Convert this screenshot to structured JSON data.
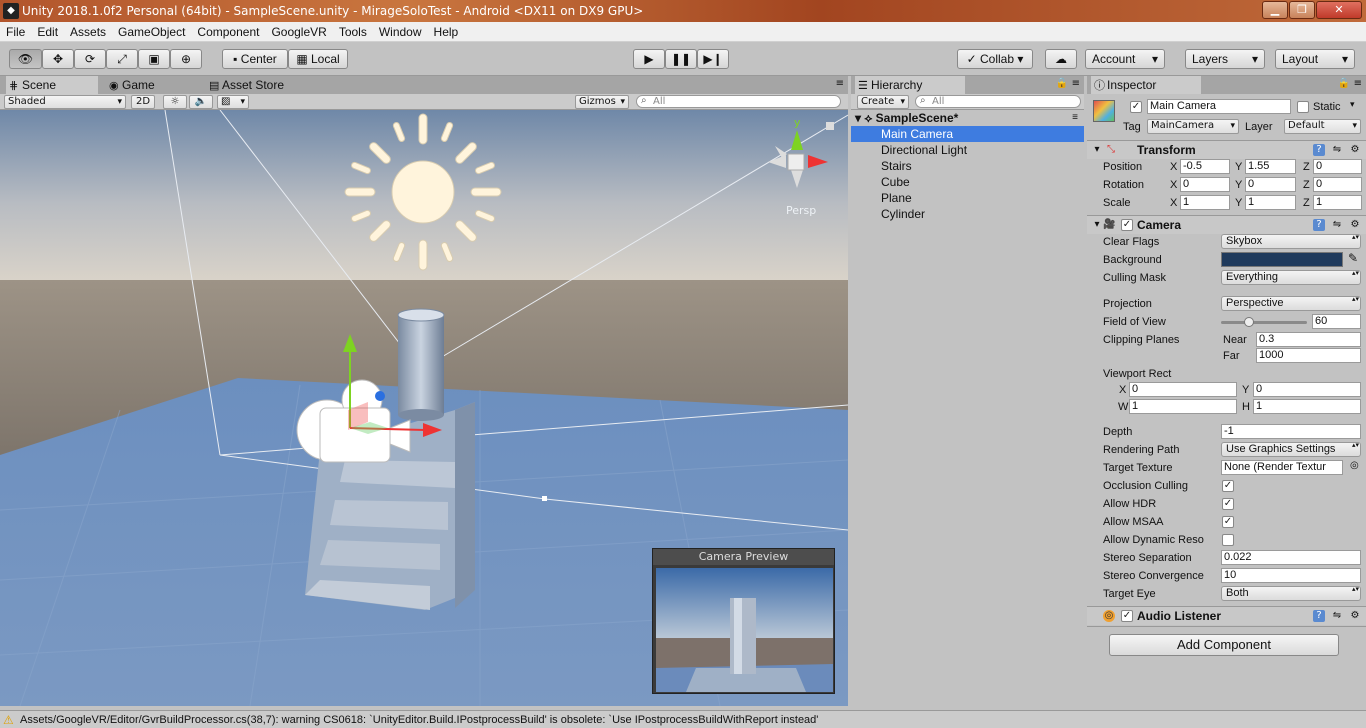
{
  "window": {
    "title": "Unity 2018.1.0f2 Personal (64bit) - SampleScene.unity - MirageSoloTest - Android <DX11 on DX9 GPU>",
    "logo_icon": "unity-logo-icon",
    "buttons": [
      "minimize-icon",
      "maximize-icon",
      "close-icon"
    ]
  },
  "menu": [
    "File",
    "Edit",
    "Assets",
    "GameObject",
    "Component",
    "GoogleVR",
    "Tools",
    "Window",
    "Help"
  ],
  "toolbar": {
    "tools": [
      "hand-tool-icon",
      "move-tool-icon",
      "rotate-tool-icon",
      "scale-tool-icon",
      "rect-tool-icon",
      "transform-tool-icon"
    ],
    "pivot_label": "Center",
    "space_label": "Local",
    "play_icons": [
      "play-icon",
      "pause-icon",
      "step-icon"
    ],
    "collab_label": "Collab",
    "account_label": "Account",
    "layers_label": "Layers",
    "layout_label": "Layout"
  },
  "scene_panel": {
    "tabs": [
      "Scene",
      "Game",
      "Asset Store"
    ],
    "shading_mode": "Shaded",
    "mode_2d": "2D",
    "gizmos_label": "Gizmos",
    "search_placeholder": "All",
    "persp_label": "Persp",
    "gizmo_axis_y": "y",
    "camera_preview_title": "Camera Preview"
  },
  "hierarchy": {
    "tab_label": "Hierarchy",
    "create_label": "Create",
    "search_placeholder": "All",
    "scene_name": "SampleScene*",
    "items": [
      "Main Camera",
      "Directional Light",
      "Stairs",
      "Cube",
      "Plane",
      "Cylinder"
    ],
    "selected": "Main Camera"
  },
  "inspector": {
    "tab_label": "Inspector",
    "object_name": "Main Camera",
    "static_label": "Static",
    "tag_label": "Tag",
    "tag_value": "MainCamera",
    "layer_label": "Layer",
    "layer_value": "Default",
    "transform": {
      "title": "Transform",
      "position_label": "Position",
      "position": {
        "x": "-0.5",
        "y": "1.55",
        "z": "0"
      },
      "rotation_label": "Rotation",
      "rotation": {
        "x": "0",
        "y": "0",
        "z": "0"
      },
      "scale_label": "Scale",
      "scale": {
        "x": "1",
        "y": "1",
        "z": "1"
      }
    },
    "axes": {
      "x": "X",
      "y": "Y",
      "z": "Z",
      "w": "W",
      "h": "H"
    },
    "camera": {
      "title": "Camera",
      "clear_flags_label": "Clear Flags",
      "clear_flags": "Skybox",
      "background_label": "Background",
      "background_color": "#1f3a5c",
      "culling_mask_label": "Culling Mask",
      "culling_mask": "Everything",
      "projection_label": "Projection",
      "projection": "Perspective",
      "fov_label": "Field of View",
      "fov": "60",
      "fov_fraction": 0.33,
      "clipping_label": "Clipping Planes",
      "near_label": "Near",
      "near": "0.3",
      "far_label": "Far",
      "far": "1000",
      "viewport_label": "Viewport Rect",
      "viewport": {
        "x": "0",
        "y": "0",
        "w": "1",
        "h": "1"
      },
      "depth_label": "Depth",
      "depth": "-1",
      "rendering_path_label": "Rendering Path",
      "rendering_path": "Use Graphics Settings",
      "target_texture_label": "Target Texture",
      "target_texture": "None (Render Textur",
      "occlusion_label": "Occlusion Culling",
      "occlusion": true,
      "hdr_label": "Allow HDR",
      "hdr": true,
      "msaa_label": "Allow MSAA",
      "msaa": true,
      "dynamic_label": "Allow Dynamic Reso",
      "dynamic": false,
      "stereo_sep_label": "Stereo Separation",
      "stereo_sep": "0.022",
      "stereo_conv_label": "Stereo Convergence",
      "stereo_conv": "10",
      "target_eye_label": "Target Eye",
      "target_eye": "Both"
    },
    "audio_listener": {
      "title": "Audio Listener"
    },
    "add_component_label": "Add Component"
  },
  "status": {
    "icon": "warning-icon",
    "message": "Assets/GoogleVR/Editor/GvrBuildProcessor.cs(38,7): warning CS0618: `UnityEditor.Build.IPostprocessBuild' is obsolete: `Use IPostprocessBuildWithReport instead'"
  }
}
